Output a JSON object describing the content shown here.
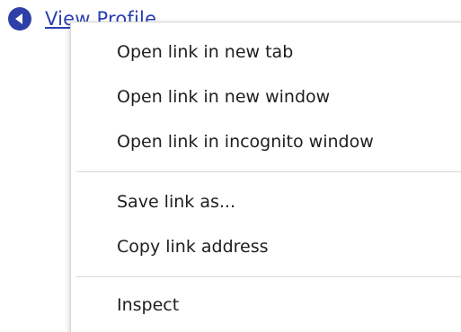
{
  "page": {
    "link": {
      "text": "View Profile",
      "icon": "back-circle-icon",
      "color": "#2a3fb0"
    }
  },
  "context_menu": {
    "groups": [
      {
        "items": [
          {
            "label": "Open link in new tab"
          },
          {
            "label": "Open link in new window"
          },
          {
            "label": "Open link in incognito window"
          }
        ]
      },
      {
        "items": [
          {
            "label": "Save link as..."
          },
          {
            "label": "Copy link address"
          }
        ]
      },
      {
        "items": [
          {
            "label": "Inspect"
          }
        ]
      }
    ]
  }
}
